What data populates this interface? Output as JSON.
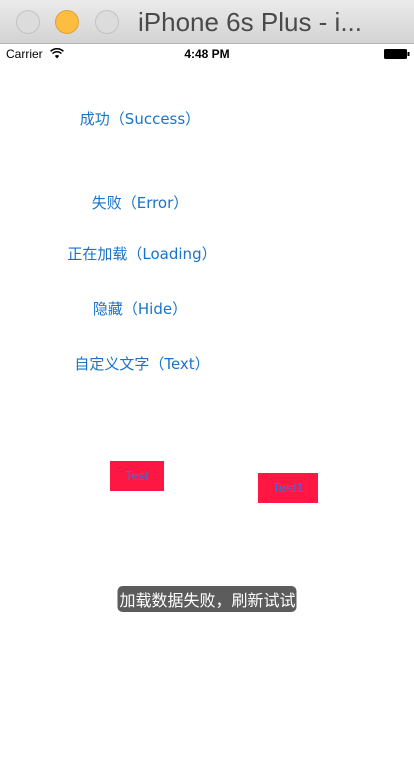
{
  "window": {
    "title": "iPhone 6s Plus - i..."
  },
  "status_bar": {
    "carrier": "Carrier",
    "time": "4:48 PM"
  },
  "buttons": {
    "success": "成功（Success）",
    "error": "失败（Error）",
    "loading": "正在加载（Loading）",
    "hide": "隐藏（Hide）",
    "custom_text": "自定义文字（Text）",
    "test": "Test",
    "test1": "Test1"
  },
  "toast": {
    "message": "加载数据失败，刷新试试"
  },
  "colors": {
    "link": "#1a73c8",
    "button_background": "#ff1744",
    "button_text": "#3d6fd8",
    "toast_background": "#464646"
  },
  "icons": [
    "wifi-icon",
    "battery-icon"
  ]
}
